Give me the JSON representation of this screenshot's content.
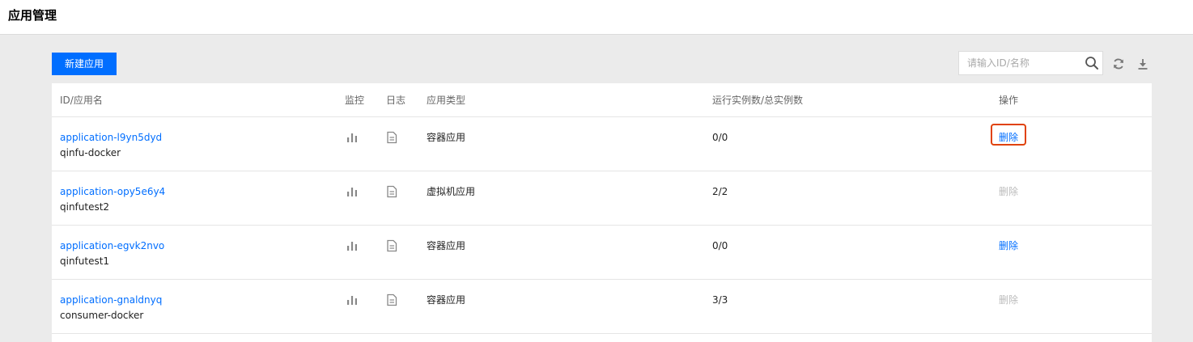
{
  "header": {
    "title": "应用管理"
  },
  "toolbar": {
    "new_button": "新建应用",
    "search_placeholder": "请输入ID/名称"
  },
  "table": {
    "columns": [
      "ID/应用名",
      "监控",
      "日志",
      "应用类型",
      "运行实例数/总实例数",
      "操作"
    ],
    "rows": [
      {
        "id": "application-l9yn5dyd",
        "name": "qinfu-docker",
        "type": "容器应用",
        "instances": "0/0",
        "action": "删除",
        "action_enabled": true,
        "highlighted": true
      },
      {
        "id": "application-opy5e6y4",
        "name": "qinfutest2",
        "type": "虚拟机应用",
        "instances": "2/2",
        "action": "删除",
        "action_enabled": false,
        "highlighted": false
      },
      {
        "id": "application-egvk2nvo",
        "name": "qinfutest1",
        "type": "容器应用",
        "instances": "0/0",
        "action": "删除",
        "action_enabled": true,
        "highlighted": false
      },
      {
        "id": "application-gnaldnyq",
        "name": "consumer-docker",
        "type": "容器应用",
        "instances": "3/3",
        "action": "删除",
        "action_enabled": false,
        "highlighted": false
      }
    ]
  },
  "icons": {
    "search": "search-icon",
    "refresh": "refresh-icon",
    "download": "download-icon",
    "monitor": "bar-chart-icon",
    "log": "document-icon"
  },
  "colors": {
    "accent": "#006eff",
    "highlight": "#e0420a",
    "disabled": "#bbbbbb"
  }
}
